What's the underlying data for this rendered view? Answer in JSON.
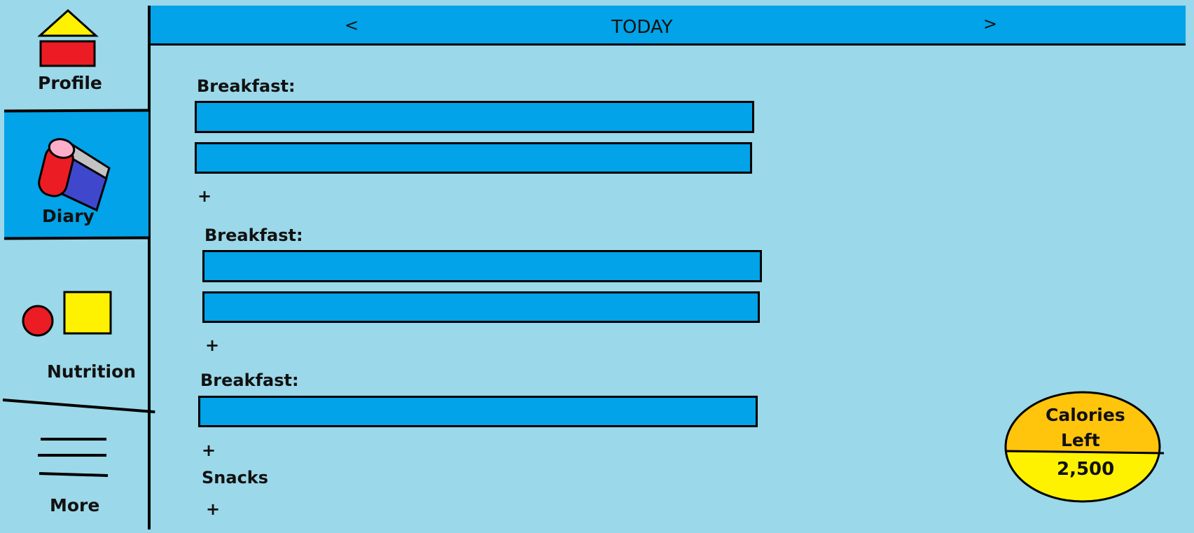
{
  "app": {
    "header": {
      "prev": "<",
      "title": "TODAY",
      "next": ">"
    },
    "sidebar": {
      "items": [
        {
          "label": "Profile"
        },
        {
          "label": "Diary"
        },
        {
          "label": "Nutrition"
        },
        {
          "label": "More"
        }
      ]
    },
    "meals": [
      {
        "label": "Breakfast:",
        "add": "+"
      },
      {
        "label": "Breakfast:",
        "add": "+"
      },
      {
        "label": "Breakfast:",
        "add": "+"
      },
      {
        "label": "Snacks",
        "add": "+"
      }
    ],
    "calories": {
      "label_line1": "Calories",
      "label_line2": "Left",
      "value": "2,500"
    }
  },
  "colors": {
    "background": "#9bd8e9",
    "header": "#02a3e8",
    "selected_nav": "#02a3e8",
    "entry_bar": "#02a3e8",
    "calories_top": "#ffc40c",
    "calories_bottom": "#fff200"
  }
}
